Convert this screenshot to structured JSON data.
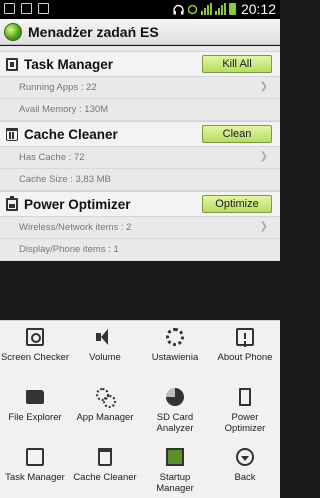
{
  "status_bar": {
    "time": "20:12"
  },
  "app": {
    "title": "Menadżer zadań ES"
  },
  "sections": [
    {
      "title": "Task Manager",
      "icon": "task-manager-icon",
      "button": "Kill All",
      "rows": [
        "Running Apps : 22",
        "Avail Memory : 130M"
      ]
    },
    {
      "title": "Cache Cleaner",
      "icon": "trash-icon",
      "button": "Clean",
      "rows": [
        "Has Cache : 72",
        "Cache Size : 3,83 MB"
      ]
    },
    {
      "title": "Power Optimizer",
      "icon": "battery-icon",
      "button": "Optimize",
      "rows": [
        "Wireless/Network items : 2",
        "Display/Phone items : 1"
      ]
    }
  ],
  "menu": [
    {
      "label": "Screen Checker",
      "icon": "screen-checker-icon"
    },
    {
      "label": "Volume",
      "icon": "speaker-icon"
    },
    {
      "label": "Ustawienia",
      "icon": "gear-icon"
    },
    {
      "label": "About Phone",
      "icon": "info-icon"
    },
    {
      "label": "File Explorer",
      "icon": "folder-icon"
    },
    {
      "label": "App Manager",
      "icon": "gears-icon"
    },
    {
      "label": "SD Card Analyzer",
      "icon": "pie-chart-icon"
    },
    {
      "label": "Power Optimizer",
      "icon": "battery-icon"
    },
    {
      "label": "Task Manager",
      "icon": "task-manager-icon"
    },
    {
      "label": "Cache Cleaner",
      "icon": "trash-icon"
    },
    {
      "label": "Startup Manager",
      "icon": "startup-chart-icon"
    },
    {
      "label": "Back",
      "icon": "back-icon"
    }
  ]
}
